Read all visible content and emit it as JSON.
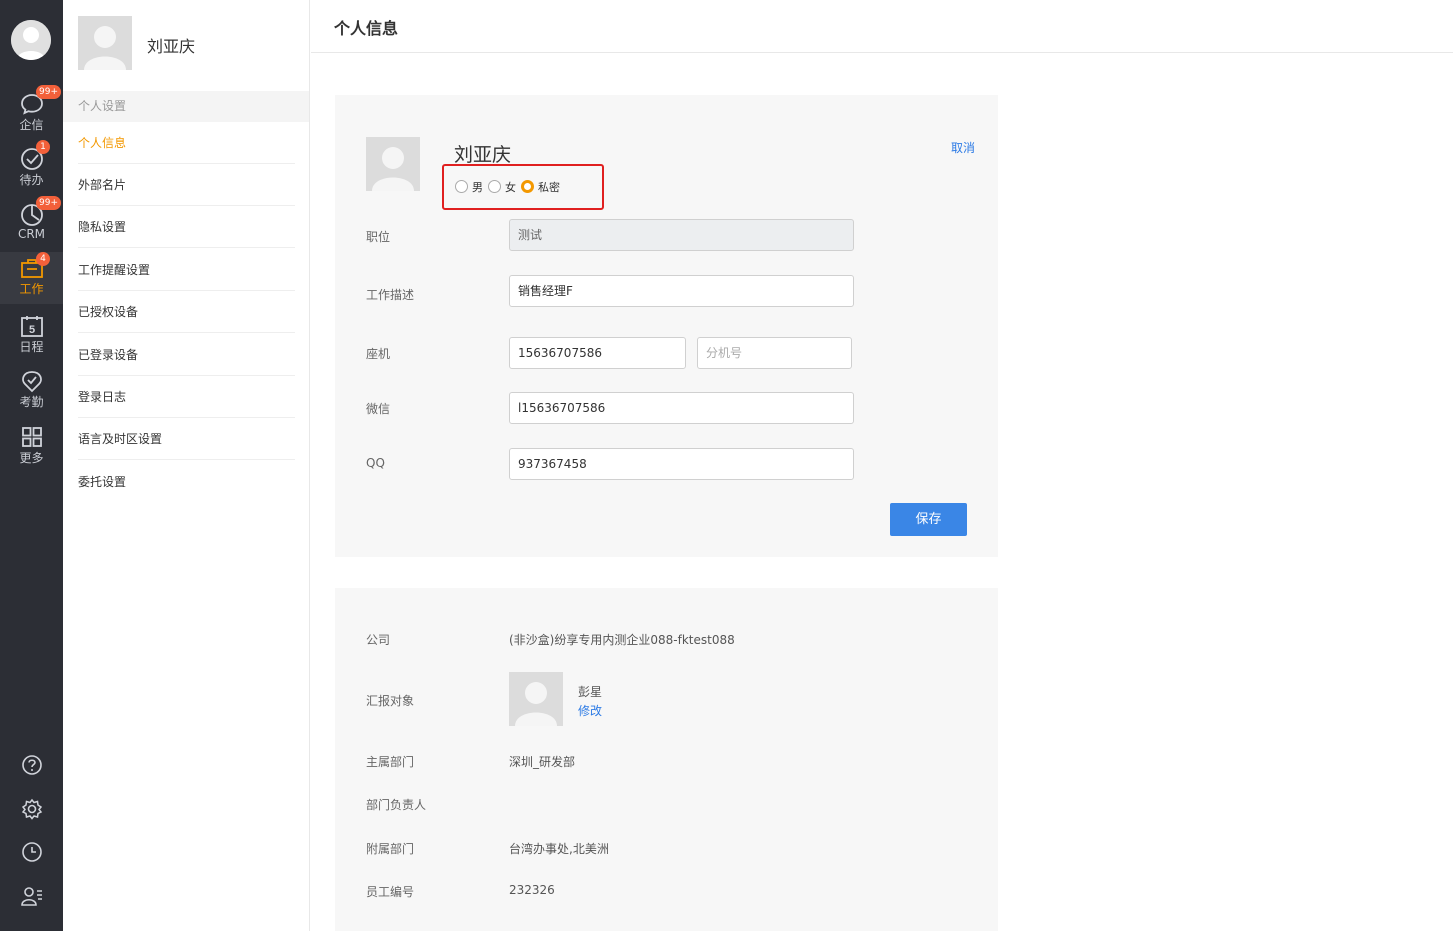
{
  "rail": {
    "items": [
      {
        "label": "企信",
        "badge": "99+"
      },
      {
        "label": "待办",
        "badge": "1"
      },
      {
        "label": "CRM",
        "badge": "99+"
      },
      {
        "label": "工作",
        "badge": "4"
      },
      {
        "label": "日程",
        "badge": "",
        "icon_text": "5"
      },
      {
        "label": "考勤",
        "badge": ""
      },
      {
        "label": "更多",
        "badge": ""
      }
    ],
    "bottom_icons": [
      "help-icon",
      "gear-icon",
      "clock-icon",
      "contacts-icon"
    ]
  },
  "sidebar": {
    "user_name": "刘亚庆",
    "section_title": "个人设置",
    "items": [
      {
        "label": "个人信息"
      },
      {
        "label": "外部名片"
      },
      {
        "label": "隐私设置"
      },
      {
        "label": "工作提醒设置"
      },
      {
        "label": "已授权设备"
      },
      {
        "label": "已登录设备"
      },
      {
        "label": "登录日志"
      },
      {
        "label": "语言及时区设置"
      },
      {
        "label": "委托设置"
      }
    ]
  },
  "header": {
    "title": "个人信息"
  },
  "profile": {
    "name": "刘亚庆",
    "cancel_label": "取消",
    "gender": {
      "male": "男",
      "female": "女",
      "private": "私密",
      "selected": "私密"
    },
    "fields": {
      "position_label": "职位",
      "position_value": "测试",
      "desc_label": "工作描述",
      "desc_value": "销售经理F",
      "phone_label": "座机",
      "phone_value": "15636707586",
      "ext_placeholder": "分机号",
      "wechat_label": "微信",
      "wechat_value": "l15636707586",
      "qq_label": "QQ",
      "qq_value": "937367458"
    },
    "save_label": "保存"
  },
  "info": {
    "company_label": "公司",
    "company_value": "(非沙盒)纷享专用内测企业088-fktest088",
    "report_label": "汇报对象",
    "report_name": "彭星",
    "report_edit": "修改",
    "main_dept_label": "主属部门",
    "main_dept_value": "深圳_研发部",
    "dept_head_label": "部门负责人",
    "sub_dept_label": "附属部门",
    "sub_dept_value": "台湾办事处,北美洲",
    "emp_no_label": "员工编号",
    "emp_no_value": "232326"
  },
  "colors": {
    "rail_bg": "#2c2e35",
    "accent": "#f39800",
    "primary": "#3a86e6",
    "badge": "#f3603a",
    "highlight_box": "#e02020"
  }
}
